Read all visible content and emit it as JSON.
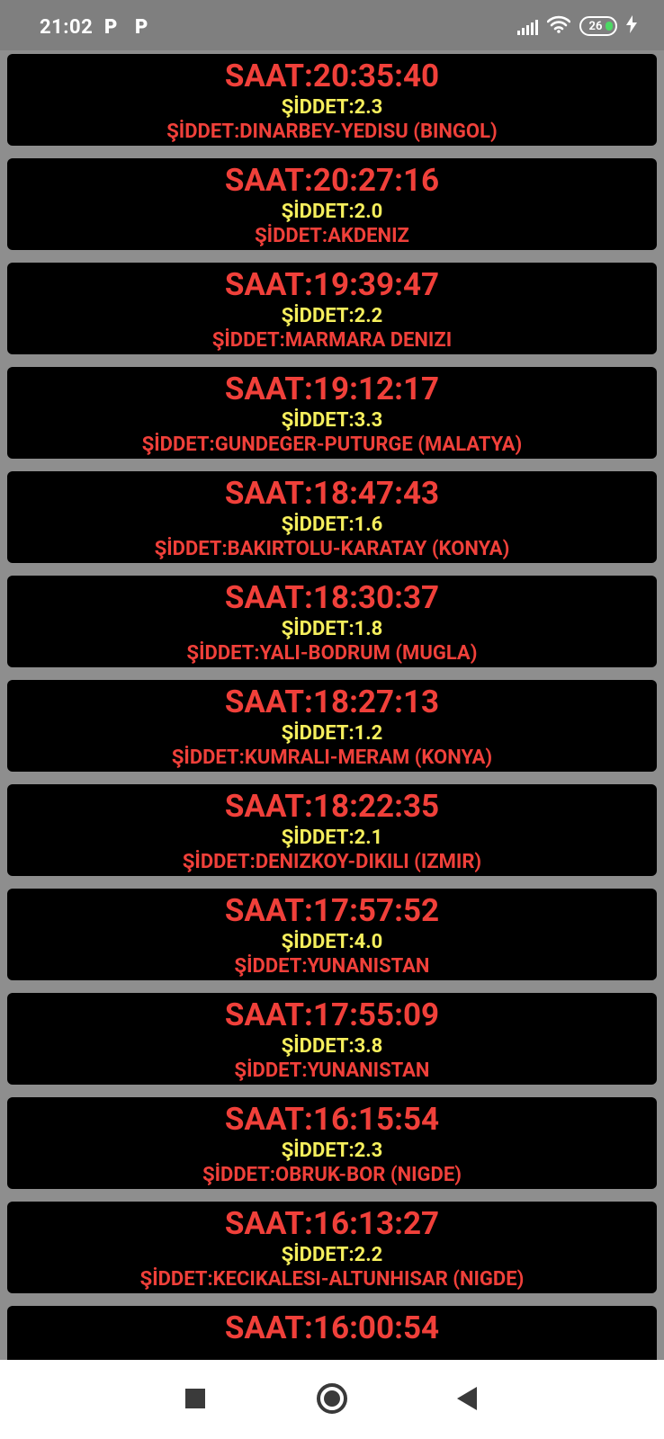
{
  "status_bar": {
    "time": "21:02",
    "notification_icons": [
      "P",
      "P"
    ],
    "battery": "26",
    "icons": [
      "signal-icon",
      "wifi-icon",
      "battery-icon",
      "charging-icon"
    ]
  },
  "colors": {
    "time_text": "#f0403a",
    "magnitude_text": "#f5ee5c",
    "location_text": "#f0403a",
    "card_background": "#000000",
    "page_background": "#8e8e8e"
  },
  "earthquakes": [
    {
      "time": "SAAT:20:35:40",
      "magnitude": "ŞİDDET:2.3",
      "location": "ŞİDDET:DINARBEY-YEDISU (BINGOL)"
    },
    {
      "time": "SAAT:20:27:16",
      "magnitude": "ŞİDDET:2.0",
      "location": "ŞİDDET:AKDENIZ"
    },
    {
      "time": "SAAT:19:39:47",
      "magnitude": "ŞİDDET:2.2",
      "location": "ŞİDDET:MARMARA DENIZI"
    },
    {
      "time": "SAAT:19:12:17",
      "magnitude": "ŞİDDET:3.3",
      "location": "ŞİDDET:GUNDEGER-PUTURGE (MALATYA)"
    },
    {
      "time": "SAAT:18:47:43",
      "magnitude": "ŞİDDET:1.6",
      "location": "ŞİDDET:BAKIRTOLU-KARATAY (KONYA)"
    },
    {
      "time": "SAAT:18:30:37",
      "magnitude": "ŞİDDET:1.8",
      "location": "ŞİDDET:YALI-BODRUM (MUGLA)"
    },
    {
      "time": "SAAT:18:27:13",
      "magnitude": "ŞİDDET:1.2",
      "location": "ŞİDDET:KUMRALI-MERAM (KONYA)"
    },
    {
      "time": "SAAT:18:22:35",
      "magnitude": "ŞİDDET:2.1",
      "location": "ŞİDDET:DENIZKOY-DIKILI (IZMIR)"
    },
    {
      "time": "SAAT:17:57:52",
      "magnitude": "ŞİDDET:4.0",
      "location": "ŞİDDET:YUNANISTAN"
    },
    {
      "time": "SAAT:17:55:09",
      "magnitude": "ŞİDDET:3.8",
      "location": "ŞİDDET:YUNANISTAN"
    },
    {
      "time": "SAAT:16:15:54",
      "magnitude": "ŞİDDET:2.3",
      "location": "ŞİDDET:OBRUK-BOR (NIGDE)"
    },
    {
      "time": "SAAT:16:13:27",
      "magnitude": "ŞİDDET:2.2",
      "location": "ŞİDDET:KECIKALESI-ALTUNHISAR (NIGDE)"
    },
    {
      "time": "SAAT:16:00:54",
      "magnitude": "",
      "location": ""
    }
  ],
  "nav_bar": {
    "buttons": [
      "recents-icon",
      "home-icon",
      "back-icon"
    ]
  }
}
